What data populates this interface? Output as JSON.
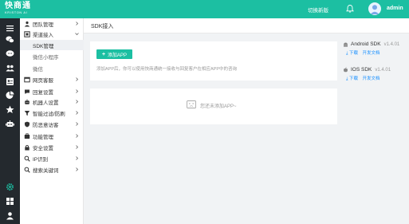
{
  "header": {
    "logo_cn": "快商通",
    "logo_en": "KRISTON AI",
    "switch_label": "切换新版",
    "username": "admin",
    "bg_color": "#1cbfa2"
  },
  "rail": {
    "icons": [
      "menu-icon",
      "chat-icon",
      "comment-icon",
      "users-icon",
      "contact-card-icon",
      "pie-chart-icon",
      "star-icon",
      "robot-icon",
      "settings-icon",
      "apps-icon",
      "user-icon"
    ]
  },
  "menu": {
    "items": [
      {
        "label": "团队管理",
        "icon": "team-icon",
        "chevron": ">"
      },
      {
        "label": "渠道接入",
        "icon": "channel-icon",
        "chevron": "v"
      },
      {
        "label": "SDK管理",
        "sub": true,
        "active": true
      },
      {
        "label": "微信小程序",
        "sub": true
      },
      {
        "label": "微信",
        "sub": true
      },
      {
        "label": "网页客服",
        "icon": "web-icon",
        "chevron": ">"
      },
      {
        "label": "回复设置",
        "icon": "reply-icon",
        "chevron": ">"
      },
      {
        "label": "机器人设置",
        "icon": "robot-icon",
        "chevron": ">"
      },
      {
        "label": "智能过滤/防刷",
        "icon": "filter-icon",
        "chevron": ">"
      },
      {
        "label": "防恶意访客",
        "icon": "shield-icon",
        "chevron": ">"
      },
      {
        "label": "功能管理",
        "icon": "function-icon",
        "chevron": ">"
      },
      {
        "label": "安全设置",
        "icon": "security-icon",
        "chevron": ">"
      },
      {
        "label": "IP识别",
        "icon": "ip-icon",
        "chevron": ">"
      },
      {
        "label": "搜索关键词",
        "icon": "search-icon",
        "chevron": ">"
      }
    ]
  },
  "main": {
    "page_title": "SDK接入",
    "add_button": "添加APP",
    "hint": "添加APP后，你可以使用快商通统一接收与回复客户在相应APP中的咨询",
    "empty_text": "您还未添加APP~"
  },
  "sdks": [
    {
      "name": "Android SDK",
      "version": "v1.4.01",
      "download": "下载",
      "docs": "开发文档"
    },
    {
      "name": "IOS SDK",
      "version": "v1.4.01",
      "download": "下载",
      "docs": "开发文档"
    }
  ]
}
